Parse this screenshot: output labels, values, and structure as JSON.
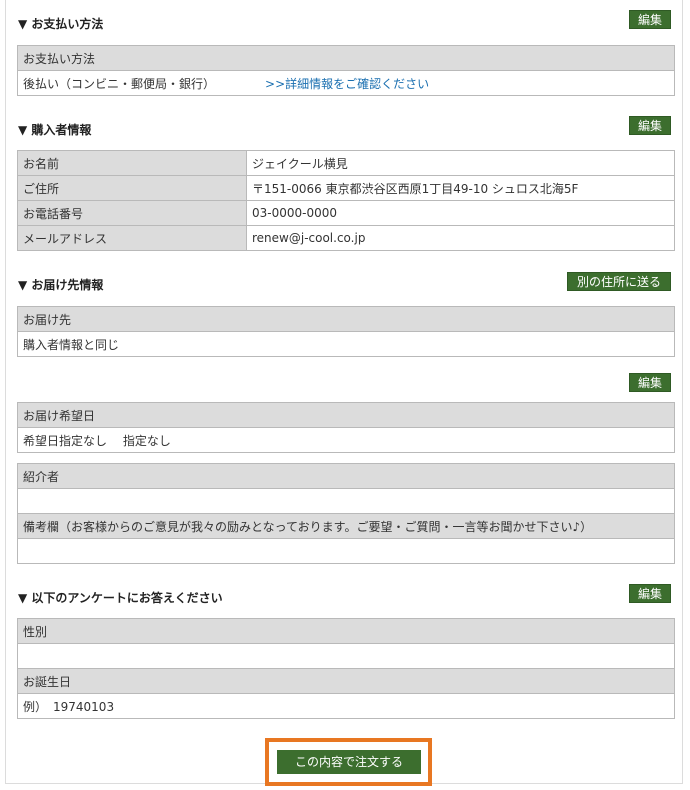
{
  "sections": {
    "payment": {
      "title": "▼ お支払い方法",
      "edit_label": "編集",
      "header": "お支払い方法",
      "value": "後払い（コンビニ・郵便局・銀行）",
      "link": ">>詳細情報をご確認ください"
    },
    "buyer": {
      "title": "▼ 購入者情報",
      "edit_label": "編集",
      "rows": [
        {
          "label": "お名前",
          "value": "ジェイクール横見"
        },
        {
          "label": "ご住所",
          "value": "〒151-0066  東京都渋谷区西原1丁目49-10 シュロス北海5F"
        },
        {
          "label": "お電話番号",
          "value": "03-0000-0000"
        },
        {
          "label": "メールアドレス",
          "value": "renew@j-cool.co.jp"
        }
      ]
    },
    "delivery": {
      "title": "▼ お届け先情報",
      "other_address_label": "別の住所に送る",
      "header": "お届け先",
      "value": "購入者情報と同じ"
    },
    "delivery_date": {
      "edit_label": "編集",
      "header": "お届け希望日",
      "value": "希望日指定なし　 指定なし",
      "referrer_header": "紹介者",
      "referrer_value": "",
      "notes_header": "備考欄（お客様からのご意見が我々の励みとなっております。ご要望・ご質問・一言等お聞かせ下さい♪）",
      "notes_value": ""
    },
    "survey": {
      "title": "▼ 以下のアンケートにお答えください",
      "edit_label": "編集",
      "gender_header": "性別",
      "gender_value": "",
      "birthday_header": "お誕生日",
      "birthday_value": "例）　19740103"
    }
  },
  "order_button": {
    "label": "この内容で注文する",
    "highlight_color": "#e87722"
  },
  "colors": {
    "button_green": "#3c6e2e",
    "header_gray": "#dcdcdc",
    "link_blue": "#1a6fb0"
  }
}
